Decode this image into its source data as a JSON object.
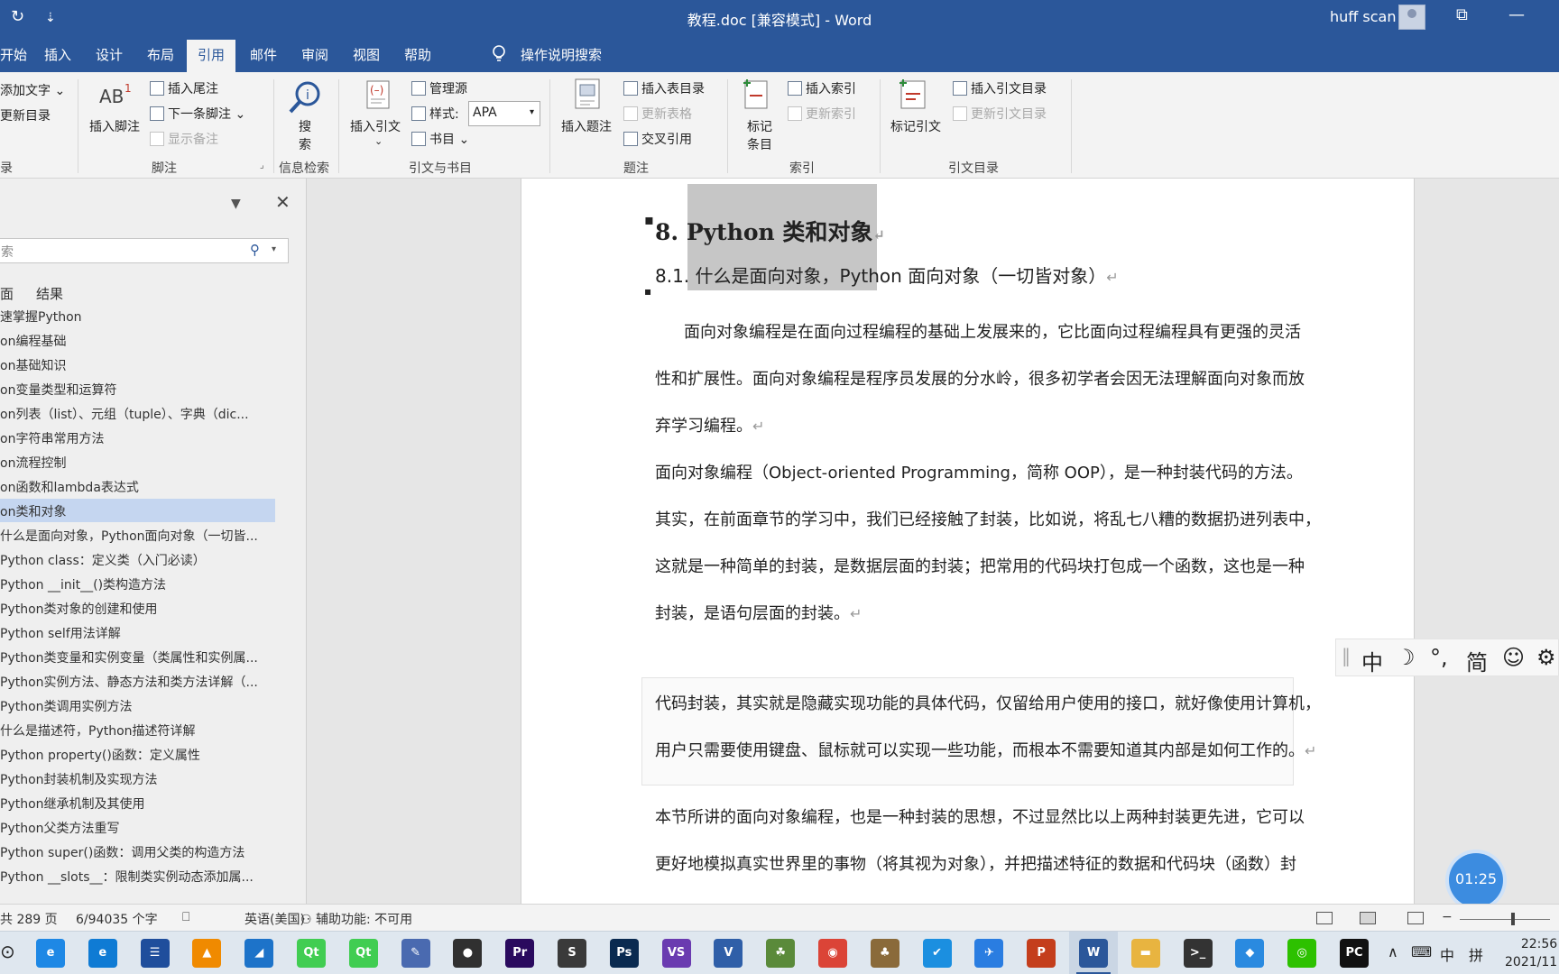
{
  "titlebar": {
    "refresh_icon": "↻",
    "qa_arrow": "⇣",
    "title": "教程.doc [兼容模式]  -  Word",
    "user": "huff scan",
    "restore_icon": "⧉",
    "minimize_icon": "—"
  },
  "tabs": [
    "开始",
    "插入",
    "设计",
    "布局",
    "引用",
    "邮件",
    "审阅",
    "视图",
    "帮助"
  ],
  "active_tab": "引用",
  "tell_me": "操作说明搜索",
  "ribbon": {
    "toc": {
      "add_text": "添加文字",
      "update_toc": "更新目录",
      "group": "录"
    },
    "footnotes": {
      "insert_footnote": "插入脚注",
      "insert_endnote": "插入尾注",
      "next_footnote": "下一条脚注",
      "show_notes": "显示备注",
      "group": "脚注"
    },
    "research": {
      "search": "搜",
      "search2": "索",
      "group": "信息检索"
    },
    "citations": {
      "insert_citation": "插入引文",
      "manage_sources": "管理源",
      "style_label": "样式:",
      "style_value": "APA",
      "bibliography": "书目",
      "group": "引文与书目"
    },
    "captions": {
      "insert_caption": "插入题注",
      "insert_table_of_figures": "插入表目录",
      "update_table": "更新表格",
      "cross_reference": "交叉引用",
      "group": "题注"
    },
    "index": {
      "mark_entry_1": "标记",
      "mark_entry_2": "条目",
      "insert_index": "插入索引",
      "update_index": "更新索引",
      "group": "索引"
    },
    "toa": {
      "mark_citation": "标记引文",
      "insert_toa": "插入引文目录",
      "update_toa": "更新引文目录",
      "group": "引文目录"
    }
  },
  "nav": {
    "search_placeholder": "索",
    "tabs": [
      "面",
      "结果"
    ],
    "items": [
      "速掌握Python",
      "on编程基础",
      "on基础知识",
      "on变量类型和运算符",
      "on列表（list）、元组（tuple）、字典（dic...",
      "on字符串常用方法",
      "on流程控制",
      "on函数和lambda表达式",
      "on类和对象",
      "什么是面向对象，Python面向对象（一切皆...",
      "Python class：定义类（入门必读）",
      "Python __init__()类构造方法",
      "Python类对象的创建和使用",
      "Python self用法详解",
      "Python类变量和实例变量（类属性和实例属...",
      "Python实例方法、静态方法和类方法详解（...",
      "Python类调用实例方法",
      "什么是描述符，Python描述符详解",
      " Python property()函数：定义属性",
      " Python封装机制及实现方法",
      " Python继承机制及其使用",
      " Python父类方法重写",
      " Python super()函数：调用父类的构造方法",
      " Python __slots__：限制类实例动态添加属..."
    ]
  },
  "document": {
    "h1_number": "8.",
    "h1_text": "Python 类和对象",
    "h2_text": "8.1. 什么是面向对象，Python 面向对象（一切皆对象）",
    "lines": [
      "面向对象编程是在面向过程编程的基础上发展来的，它比面向过程编程具有更强的灵活",
      "性和扩展性。面向对象编程是程序员发展的分水岭，很多初学者会因无法理解面向对象而放",
      "弃学习编程。",
      "面向对象编程（Object-oriented Programming，简称 OOP），是一种封装代码的方法。",
      "其实，在前面章节的学习中，我们已经接触了封装，比如说，将乱七八糟的数据扔进列表中，",
      "这就是一种简单的封装，是数据层面的封装；把常用的代码块打包成一个函数，这也是一种",
      "封装，是语句层面的封装。",
      "代码封装，其实就是隐藏实现功能的具体代码，仅留给用户使用的接口，就好像使用计算机，",
      "用户只需要使用键盘、鼠标就可以实现一些功能，而根本不需要知道其内部是如何工作的。",
      "本节所讲的面向对象编程，也是一种封装的思想，不过显然比以上两种封装更先进，它可以",
      "更好地模拟真实世界里的事物（将其视为对象），并把描述特征的数据和代码块（函数）封"
    ],
    "para_mark": "↵"
  },
  "ime": {
    "chinese": "中",
    "moon": "☽",
    "punct": "°,",
    "simplified": "简",
    "emoji": "☺",
    "settings": "⚙"
  },
  "timer": "01:25",
  "status": {
    "pages": "共 289 页",
    "words": "6/94035 个字",
    "language": "英语(美国)",
    "accessibility": "辅助功能: 不可用"
  },
  "taskbar": {
    "apps": [
      {
        "name": "ie",
        "label": "e",
        "color": "#1e88e5"
      },
      {
        "name": "edge",
        "label": "e",
        "color": "#0f7bd4"
      },
      {
        "name": "app-3",
        "label": "☰",
        "color": "#1f4e9c"
      },
      {
        "name": "vlc",
        "label": "▲",
        "color": "#f08a00"
      },
      {
        "name": "app-5",
        "label": "◢",
        "color": "#1d73c9"
      },
      {
        "name": "qt-1",
        "label": "Qt",
        "color": "#41cd52"
      },
      {
        "name": "qt-2",
        "label": "Qt",
        "color": "#41cd52"
      },
      {
        "name": "app-8",
        "label": "✎",
        "color": "#4a6ab0"
      },
      {
        "name": "obs",
        "label": "●",
        "color": "#303030"
      },
      {
        "name": "premiere",
        "label": "Pr",
        "color": "#2a0a5e"
      },
      {
        "name": "sublime",
        "label": "S",
        "color": "#3a3a3a"
      },
      {
        "name": "photoshop",
        "label": "Ps",
        "color": "#0a2a50"
      },
      {
        "name": "visual-studio",
        "label": "VS",
        "color": "#6a3bb0"
      },
      {
        "name": "visio",
        "label": "V",
        "color": "#2f5fa8"
      },
      {
        "name": "app-15",
        "label": "☘",
        "color": "#5a8a3a"
      },
      {
        "name": "chrome",
        "label": "◉",
        "color": "#db4437"
      },
      {
        "name": "app-17",
        "label": "♣",
        "color": "#8a6a3a"
      },
      {
        "name": "app-18",
        "label": "✔",
        "color": "#1b8fe0"
      },
      {
        "name": "app-19",
        "label": "✈",
        "color": "#2a7de1"
      },
      {
        "name": "powerpoint",
        "label": "P",
        "color": "#c43e1c"
      },
      {
        "name": "word",
        "label": "W",
        "color": "#2b579a"
      },
      {
        "name": "explorer",
        "label": "▬",
        "color": "#e8b440"
      },
      {
        "name": "terminal",
        "label": ">_",
        "color": "#333333"
      },
      {
        "name": "app-24",
        "label": "◆",
        "color": "#2a8ae0"
      },
      {
        "name": "wechat",
        "label": "◎",
        "color": "#2dc100"
      },
      {
        "name": "pycharm",
        "label": "PC",
        "color": "#111111"
      }
    ],
    "tray_chevron": "∧",
    "tray_ime": "中",
    "tray_layout": "拼",
    "time": "22:56",
    "date": "2021/11"
  },
  "colors": {
    "accent": "#2b579a",
    "nav_selected": "#c5d6f0",
    "heading_highlight": "#c6c6c6"
  }
}
